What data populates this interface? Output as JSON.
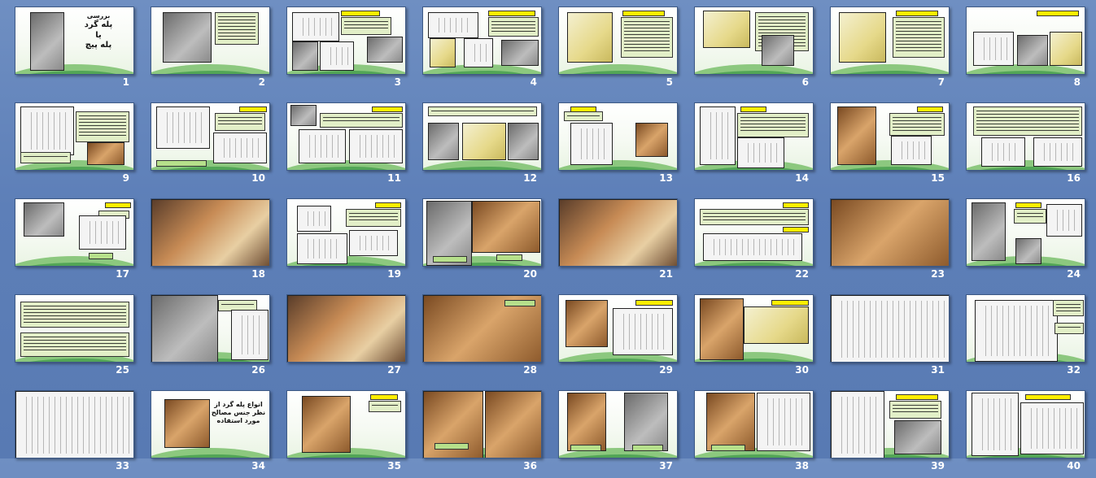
{
  "slides": [
    {
      "n": "1",
      "title": [
        "بررسی",
        "پله گرد",
        "یا",
        "پله پیچ"
      ]
    },
    {
      "n": "2"
    },
    {
      "n": "3"
    },
    {
      "n": "4"
    },
    {
      "n": "5"
    },
    {
      "n": "6"
    },
    {
      "n": "7"
    },
    {
      "n": "8"
    },
    {
      "n": "9"
    },
    {
      "n": "10"
    },
    {
      "n": "11"
    },
    {
      "n": "12"
    },
    {
      "n": "13"
    },
    {
      "n": "14"
    },
    {
      "n": "15"
    },
    {
      "n": "16"
    },
    {
      "n": "17"
    },
    {
      "n": "18"
    },
    {
      "n": "19"
    },
    {
      "n": "20"
    },
    {
      "n": "21"
    },
    {
      "n": "22"
    },
    {
      "n": "23"
    },
    {
      "n": "24"
    },
    {
      "n": "25"
    },
    {
      "n": "26"
    },
    {
      "n": "27"
    },
    {
      "n": "28"
    },
    {
      "n": "29"
    },
    {
      "n": "30"
    },
    {
      "n": "31"
    },
    {
      "n": "32"
    },
    {
      "n": "33"
    },
    {
      "n": "34",
      "title": [
        "انواع پله گرد از",
        "نظر جنس مصالح",
        "مورد استفاده"
      ]
    },
    {
      "n": "35"
    },
    {
      "n": "36"
    },
    {
      "n": "37"
    },
    {
      "n": "38"
    },
    {
      "n": "39"
    },
    {
      "n": "40"
    }
  ]
}
